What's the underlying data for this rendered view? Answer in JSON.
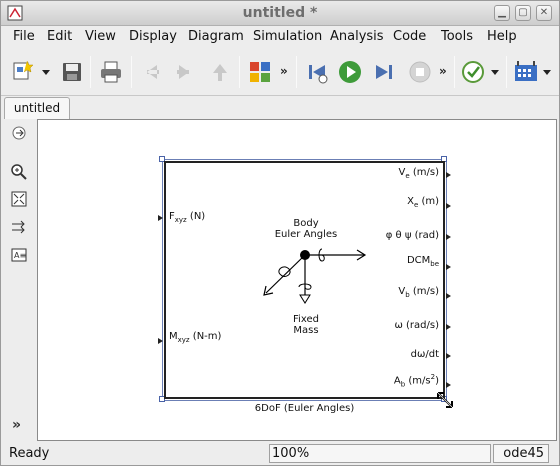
{
  "window": {
    "title": "untitled *"
  },
  "menubar": {
    "items": [
      "File",
      "Edit",
      "View",
      "Display",
      "Diagram",
      "Simulation",
      "Analysis",
      "Code",
      "Tools",
      "Help"
    ]
  },
  "toolbar": {
    "icons": [
      "new-model-icon",
      "save-icon",
      "print-icon",
      "back-icon",
      "forward-icon",
      "up-icon",
      "library-browser-icon",
      "step-back-icon",
      "run-icon",
      "step-forward-icon",
      "stop-icon",
      "model-advisor-icon",
      "build-icon"
    ]
  },
  "tabs": [
    {
      "label": "untitled"
    }
  ],
  "block": {
    "name": "6DoF (Euler Angles)",
    "inputs": {
      "force": "F",
      "force_sub": "xyz",
      "force_unit": "(N)",
      "moment": "M",
      "moment_sub": "xyz",
      "moment_unit": "(N-m)"
    },
    "outputs": [
      {
        "main": "V",
        "sub": "e",
        "unit": "(m/s)"
      },
      {
        "main": "X",
        "sub": "e",
        "unit": "(m)"
      },
      {
        "main": "φ θ ψ",
        "sub": "",
        "unit": "(rad)"
      },
      {
        "main": "DCM",
        "sub": "be",
        "unit": ""
      },
      {
        "main": "V",
        "sub": "b",
        "unit": "(m/s)"
      },
      {
        "main": "ω",
        "sub": "",
        "unit": "(rad/s)"
      },
      {
        "main": "dω/dt",
        "sub": "",
        "unit": ""
      },
      {
        "main": "A",
        "sub": "b",
        "unit": "(m/s",
        "sup": "2",
        "tail": ")"
      }
    ],
    "center_top_line1": "Body",
    "center_top_line2": "Euler Angles",
    "center_bottom_line1": "Fixed",
    "center_bottom_line2": "Mass"
  },
  "statusbar": {
    "status": "Ready",
    "zoom": "100%",
    "solver": "ode45"
  }
}
